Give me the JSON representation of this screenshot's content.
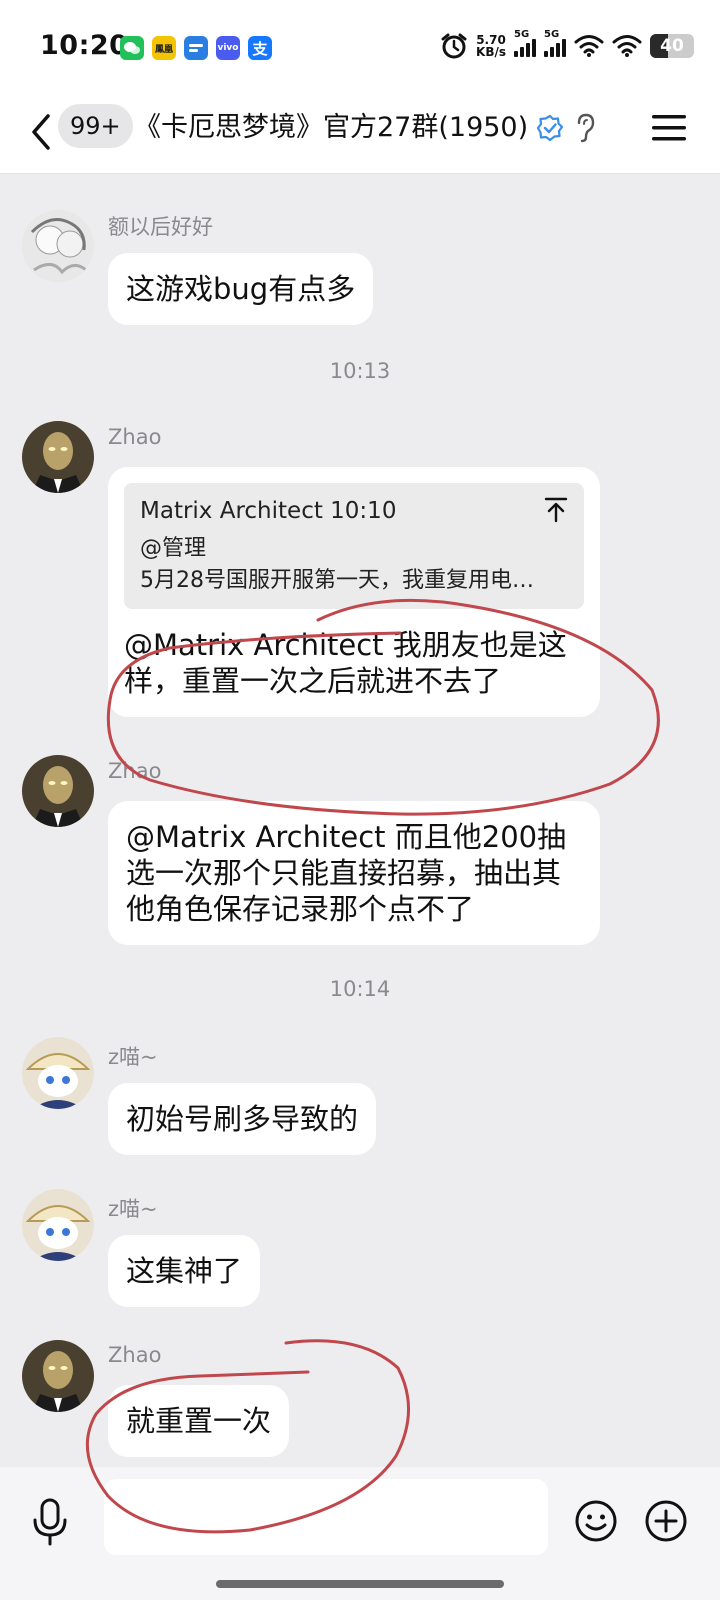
{
  "status_bar": {
    "time": "10:20",
    "apps": [
      {
        "icon": "wechat-icon",
        "label": "",
        "color": "#22c05a"
      },
      {
        "icon": "app-icon",
        "label": "鳳凰",
        "color": "#f5c400"
      },
      {
        "icon": "chat-app-icon",
        "label": "",
        "color": "#2a7de1"
      },
      {
        "icon": "vivo-icon",
        "label": "vivo",
        "color": "#4a5cf0"
      },
      {
        "icon": "alipay-icon",
        "label": "支",
        "color": "#1677ff"
      }
    ],
    "net_speed_value": "5.70",
    "net_speed_unit": "KB/s",
    "signal1_tag": "5G",
    "signal2_tag": "5G",
    "battery": "40",
    "battery_level": 0.4
  },
  "header": {
    "unread_badge": "99+",
    "title": "《卡厄思梦境》官方27群(1950)"
  },
  "messages": {
    "m1": {
      "sender": "额以后好好",
      "text": "这游戏bug有点多"
    },
    "t1": "10:13",
    "m2": {
      "sender": "Zhao",
      "quote_author_time": "Matrix Architect 10:10",
      "quote_line1": "@管理",
      "quote_line2": "5月28号国服开服第一天，我重复用电…",
      "text": "@Matrix Architect 我朋友也是这样，重置一次之后就进不去了"
    },
    "m3": {
      "sender": "Zhao",
      "text": "@Matrix Architect 而且他200抽选一次那个只能直接招募，抽出其他角色保存记录那个点不了"
    },
    "t2": "10:14",
    "m4": {
      "sender": "z喵~",
      "text": "初始号刷多导致的"
    },
    "m5": {
      "sender": "z喵~",
      "text": "这集神了"
    },
    "m6": {
      "sender": "Zhao",
      "text": "就重置一次"
    }
  },
  "input_bar": {
    "placeholder": ""
  },
  "colors": {
    "annotation": "#c0474b",
    "verify": "#3a8ee6",
    "chat_bg": "#ededf0"
  }
}
